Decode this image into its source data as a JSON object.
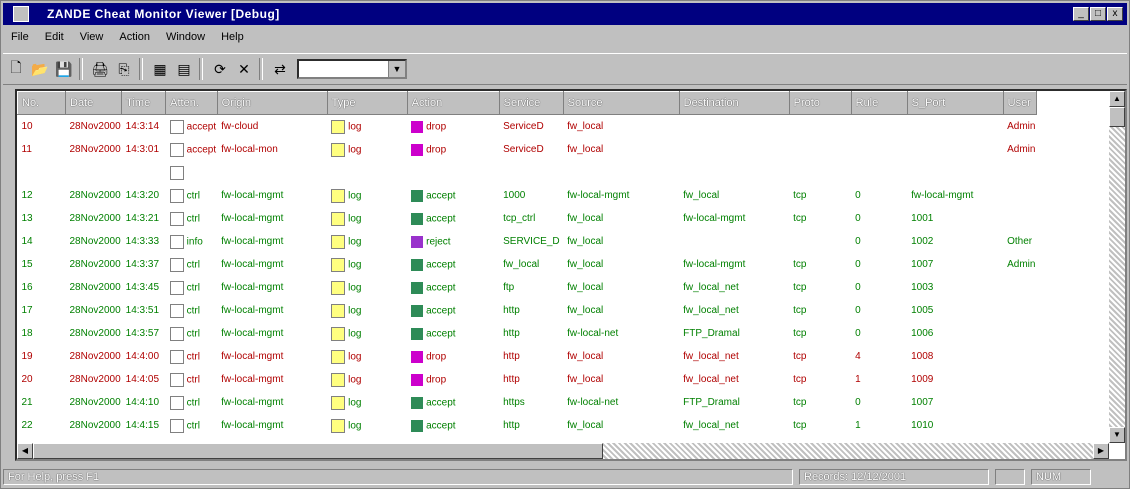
{
  "window": {
    "title": "ZANDE Cheat Monitor Viewer [Debug]",
    "controls": [
      "_",
      "□",
      "x"
    ]
  },
  "menu": [
    "File",
    "Edit",
    "View",
    "Action",
    "Window",
    "Help"
  ],
  "toolbar": {
    "icons": [
      "new-icon",
      "open-icon",
      "save-icon",
      "print-icon",
      "copy-icon",
      "filter-icon",
      "sort-icon",
      "refresh-icon",
      "clear-icon",
      "connect-icon"
    ],
    "combo_value": ""
  },
  "table": {
    "columns": [
      "No.",
      "Date",
      "Time",
      "Atten.",
      "Origin",
      "Type",
      "Action",
      "Service",
      "Source",
      "Destination",
      "Proto",
      "Rule",
      "S_Port",
      "User"
    ],
    "rows": [
      {
        "no": "10",
        "date": "28Nov2000",
        "time": "14:3:14",
        "atten": "accept",
        "origin": "fw-cloud",
        "type": "log",
        "action": "drop",
        "service": "ServiceD",
        "source": "fw_local",
        "destination": "",
        "proto": "",
        "rule": "",
        "sport": "",
        "user": "Admin",
        "alert": true
      },
      {
        "no": "11",
        "date": "28Nov2000",
        "time": "14:3:01",
        "atten": "accept",
        "origin": "fw-local-mon",
        "type": "log",
        "action": "drop",
        "service": "ServiceD",
        "source": "fw_local",
        "destination": "",
        "proto": "",
        "rule": "",
        "sport": "",
        "user": "Admin",
        "alert": true
      },
      {
        "no": "",
        "date": "",
        "time": "",
        "atten": "",
        "origin": "",
        "type": "",
        "action": "",
        "service": "",
        "source": "",
        "destination": "",
        "proto": "",
        "rule": "",
        "sport": "",
        "user": "",
        "alert": false
      },
      {
        "no": "12",
        "date": "28Nov2000",
        "time": "14:3:20",
        "atten": "ctrl",
        "origin": "fw-local-mgmt",
        "type": "log",
        "action": "accept",
        "service": "1000",
        "source": "fw-local-mgmt",
        "destination": "fw_local",
        "proto": "tcp",
        "rule": "0",
        "sport": "fw-local-mgmt",
        "user": "",
        "alert": false
      },
      {
        "no": "13",
        "date": "28Nov2000",
        "time": "14:3:21",
        "atten": "ctrl",
        "origin": "fw-local-mgmt",
        "type": "log",
        "action": "accept",
        "service": "tcp_ctrl",
        "source": "fw_local",
        "destination": "fw-local-mgmt",
        "proto": "tcp",
        "rule": "0",
        "sport": "1001",
        "user": "",
        "alert": false
      },
      {
        "no": "14",
        "date": "28Nov2000",
        "time": "14:3:33",
        "atten": "info",
        "origin": "fw-local-mgmt",
        "type": "log",
        "action": "reject",
        "service": "SERVICE_D",
        "source": "fw_local",
        "destination": "",
        "proto": "",
        "rule": "0",
        "sport": "1002",
        "user": "Other",
        "alert": false
      },
      {
        "no": "15",
        "date": "28Nov2000",
        "time": "14:3:37",
        "atten": "ctrl",
        "origin": "fw-local-mgmt",
        "type": "log",
        "action": "accept",
        "service": "fw_local",
        "source": "fw_local",
        "destination": "fw-local-mgmt",
        "proto": "tcp",
        "rule": "0",
        "sport": "1007",
        "user": "Admin",
        "alert": false
      },
      {
        "no": "16",
        "date": "28Nov2000",
        "time": "14:3:45",
        "atten": "ctrl",
        "origin": "fw-local-mgmt",
        "type": "log",
        "action": "accept",
        "service": "ftp",
        "source": "fw_local",
        "destination": "fw_local_net",
        "proto": "tcp",
        "rule": "0",
        "sport": "1003",
        "user": "",
        "alert": false
      },
      {
        "no": "17",
        "date": "28Nov2000",
        "time": "14:3:51",
        "atten": "ctrl",
        "origin": "fw-local-mgmt",
        "type": "log",
        "action": "accept",
        "service": "http",
        "source": "fw_local",
        "destination": "fw_local_net",
        "proto": "tcp",
        "rule": "0",
        "sport": "1005",
        "user": "",
        "alert": false
      },
      {
        "no": "18",
        "date": "28Nov2000",
        "time": "14:3:57",
        "atten": "ctrl",
        "origin": "fw-local-mgmt",
        "type": "log",
        "action": "accept",
        "service": "http",
        "source": "fw-local-net",
        "destination": "FTP_Dramal",
        "proto": "tcp",
        "rule": "0",
        "sport": "1006",
        "user": "",
        "alert": false
      },
      {
        "no": "19",
        "date": "28Nov2000",
        "time": "14:4:00",
        "atten": "ctrl",
        "origin": "fw-local-mgmt",
        "type": "log",
        "action": "drop",
        "service": "http",
        "source": "fw_local",
        "destination": "fw_local_net",
        "proto": "tcp",
        "rule": "4",
        "sport": "1008",
        "user": "",
        "alert": true
      },
      {
        "no": "20",
        "date": "28Nov2000",
        "time": "14:4:05",
        "atten": "ctrl",
        "origin": "fw-local-mgmt",
        "type": "log",
        "action": "drop",
        "service": "http",
        "source": "fw_local",
        "destination": "fw_local_net",
        "proto": "tcp",
        "rule": "1",
        "sport": "1009",
        "user": "",
        "alert": true
      },
      {
        "no": "21",
        "date": "28Nov2000",
        "time": "14:4:10",
        "atten": "ctrl",
        "origin": "fw-local-mgmt",
        "type": "log",
        "action": "accept",
        "service": "https",
        "source": "fw-local-net",
        "destination": "FTP_Dramal",
        "proto": "tcp",
        "rule": "0",
        "sport": "1007",
        "user": "",
        "alert": false
      },
      {
        "no": "22",
        "date": "28Nov2000",
        "time": "14:4:15",
        "atten": "ctrl",
        "origin": "fw-local-mgmt",
        "type": "log",
        "action": "accept",
        "service": "http",
        "source": "fw_local",
        "destination": "fw_local_net",
        "proto": "tcp",
        "rule": "1",
        "sport": "1010",
        "user": "",
        "alert": false
      }
    ]
  },
  "status": {
    "left": "For Help, press F1",
    "records": "Records: 12/12/2001",
    "mode": "NUM"
  }
}
